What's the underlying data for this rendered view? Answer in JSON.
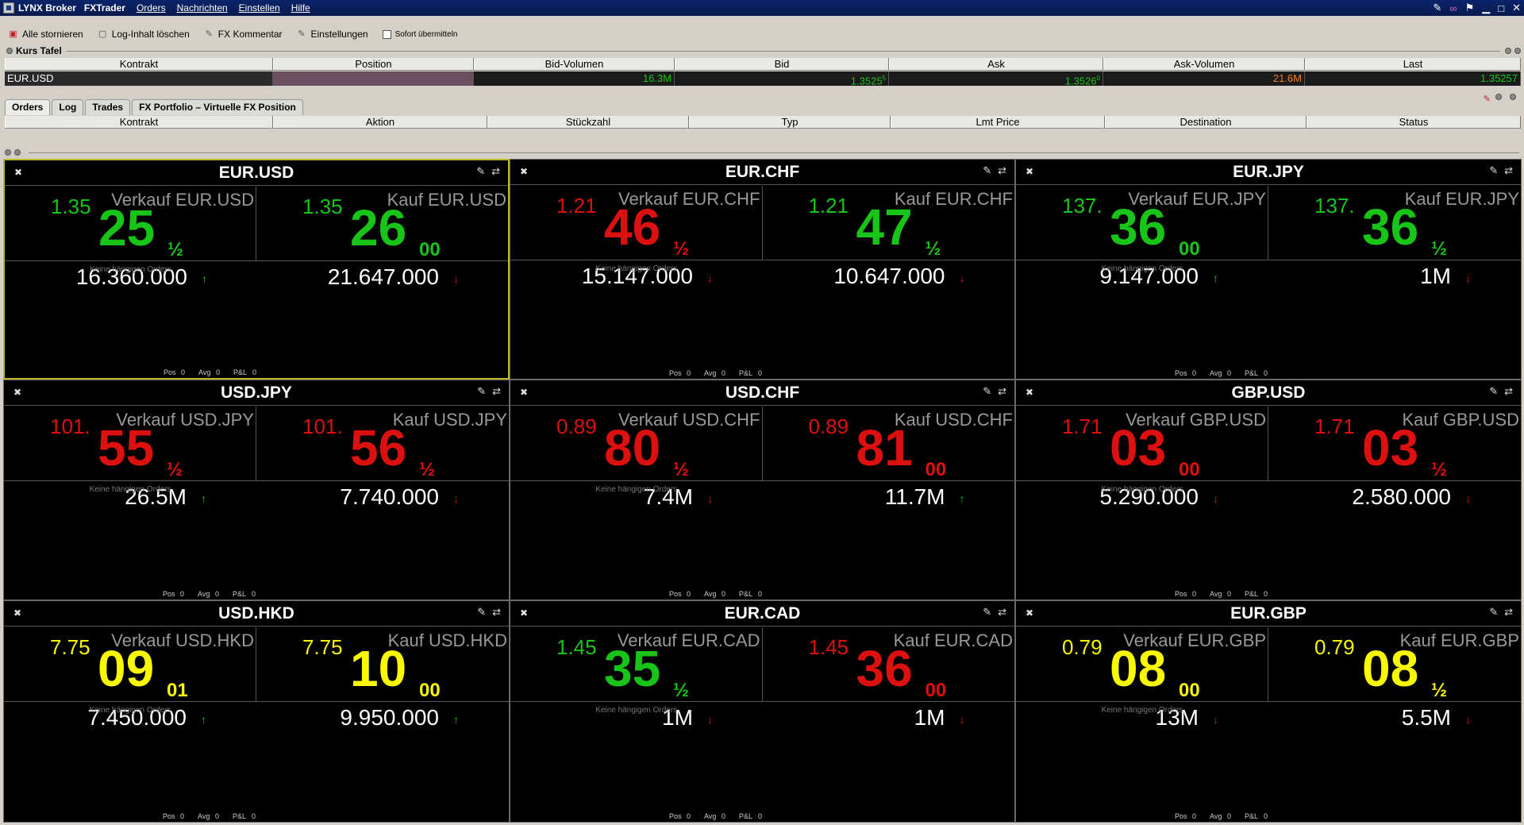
{
  "titlebar": {
    "brand": "LYNX Broker",
    "app": "FXTrader",
    "menus": [
      "Orders",
      "Nachrichten",
      "Einstellen",
      "Hilfe"
    ],
    "right_icons": [
      "wrench-icon",
      "link-icon",
      "flag-icon",
      "minimize-icon",
      "maximize-icon",
      "close-icon"
    ]
  },
  "toolbar": {
    "cancel_all": "Alle stornieren",
    "clear_log": "Log-Inhalt löschen",
    "fx_comment": "FX Kommentar",
    "settings": "Einstellungen",
    "send_now": "Sofort übermitteln"
  },
  "kurs_tafel": {
    "title": "Kurs Tafel",
    "columns": [
      "Kontrakt",
      "Position",
      "Bid-Volumen",
      "Bid",
      "Ask",
      "Ask-Volumen",
      "Last"
    ],
    "row": {
      "kontrakt": "EUR.USD",
      "position": "",
      "bid_volume": "16.3M",
      "bid": "1.3525",
      "bid_sup": "5",
      "ask": "1.3526",
      "ask_sup": "0",
      "ask_volume": "21.6M",
      "last": "1.35257"
    }
  },
  "order_panel": {
    "tabs": [
      "Orders",
      "Log",
      "Trades",
      "FX Portfolio – Virtuelle FX Position"
    ],
    "columns": [
      "Kontrakt",
      "Aktion",
      "Stückzahl",
      "Typ",
      "Lmt Price",
      "Destination",
      "Status"
    ]
  },
  "tiles": [
    {
      "symbol": "EUR.USD",
      "sell_label": "Verkauf EUR.USD",
      "buy_label": "Kauf EUR.USD",
      "bid_prefix": "1.35",
      "bid_big": "25",
      "bid_frac": "½",
      "ask_prefix": "1.35",
      "ask_big": "26",
      "ask_frac": "00",
      "bid_volume": "16.360.000",
      "ask_volume": "21.647.000",
      "bid_trend": "up",
      "ask_trend": "down",
      "bid_color": "green",
      "ask_color": "green",
      "bid_prefix_color": "green",
      "ask_prefix_color": "green",
      "pending": "Keine hängigen Orders",
      "pos": "0",
      "avg": "0",
      "pnl": "0"
    },
    {
      "symbol": "EUR.CHF",
      "sell_label": "Verkauf EUR.CHF",
      "buy_label": "Kauf EUR.CHF",
      "bid_prefix": "1.21",
      "bid_big": "46",
      "bid_frac": "½",
      "ask_prefix": "1.21",
      "ask_big": "47",
      "ask_frac": "½",
      "bid_volume": "15.147.000",
      "ask_volume": "10.647.000",
      "bid_trend": "down",
      "ask_trend": "down",
      "bid_color": "red",
      "ask_color": "green",
      "bid_prefix_color": "red",
      "ask_prefix_color": "green",
      "pending": "Keine hängigen Orders",
      "pos": "0",
      "avg": "0",
      "pnl": "0"
    },
    {
      "symbol": "EUR.JPY",
      "sell_label": "Verkauf EUR.JPY",
      "buy_label": "Kauf EUR.JPY",
      "bid_prefix": "137.",
      "bid_big": "36",
      "bid_frac": "00",
      "ask_prefix": "137.",
      "ask_big": "36",
      "ask_frac": "½",
      "bid_volume": "9.147.000",
      "ask_volume": "1M",
      "bid_trend": "up",
      "ask_trend": "down",
      "bid_color": "green",
      "ask_color": "green",
      "bid_prefix_color": "green",
      "ask_prefix_color": "green",
      "pending": "Keine hängigen Orders",
      "pos": "0",
      "avg": "0",
      "pnl": "0"
    },
    {
      "symbol": "USD.JPY",
      "sell_label": "Verkauf USD.JPY",
      "buy_label": "Kauf USD.JPY",
      "bid_prefix": "101.",
      "bid_big": "55",
      "bid_frac": "½",
      "ask_prefix": "101.",
      "ask_big": "56",
      "ask_frac": "½",
      "bid_volume": "26.5M",
      "ask_volume": "7.740.000",
      "bid_trend": "up",
      "ask_trend": "down",
      "bid_color": "red",
      "ask_color": "red",
      "bid_prefix_color": "red",
      "ask_prefix_color": "red",
      "pending": "Keine hängigen Orders",
      "pos": "0",
      "avg": "0",
      "pnl": "0"
    },
    {
      "symbol": "USD.CHF",
      "sell_label": "Verkauf USD.CHF",
      "buy_label": "Kauf USD.CHF",
      "bid_prefix": "0.89",
      "bid_big": "80",
      "bid_frac": "½",
      "ask_prefix": "0.89",
      "ask_big": "81",
      "ask_frac": "00",
      "bid_volume": "7.4M",
      "ask_volume": "11.7M",
      "bid_trend": "down",
      "ask_trend": "up",
      "bid_color": "red",
      "ask_color": "red",
      "bid_prefix_color": "red",
      "ask_prefix_color": "red",
      "pending": "Keine hängigen Orders",
      "pos": "0",
      "avg": "0",
      "pnl": "0"
    },
    {
      "symbol": "GBP.USD",
      "sell_label": "Verkauf GBP.USD",
      "buy_label": "Kauf GBP.USD",
      "bid_prefix": "1.71",
      "bid_big": "03",
      "bid_frac": "00",
      "ask_prefix": "1.71",
      "ask_big": "03",
      "ask_frac": "½",
      "bid_volume": "5.290.000",
      "ask_volume": "2.580.000",
      "bid_trend": "down",
      "ask_trend": "down",
      "bid_color": "red",
      "ask_color": "red",
      "bid_prefix_color": "red",
      "ask_prefix_color": "red",
      "pending": "Keine hängigen Orders",
      "pos": "0",
      "avg": "0",
      "pnl": "0"
    },
    {
      "symbol": "USD.HKD",
      "sell_label": "Verkauf USD.HKD",
      "buy_label": "Kauf USD.HKD",
      "bid_prefix": "7.75",
      "bid_big": "09",
      "bid_frac": "01",
      "ask_prefix": "7.75",
      "ask_big": "10",
      "ask_frac": "00",
      "bid_volume": "7.450.000",
      "ask_volume": "9.950.000",
      "bid_trend": "up",
      "ask_trend": "up",
      "bid_color": "yellow",
      "ask_color": "yellow",
      "bid_prefix_color": "yellow",
      "ask_prefix_color": "yellow",
      "pending": "Keine hängigen Orders",
      "pos": "0",
      "avg": "0",
      "pnl": "0"
    },
    {
      "symbol": "EUR.CAD",
      "sell_label": "Verkauf EUR.CAD",
      "buy_label": "Kauf EUR.CAD",
      "bid_prefix": "1.45",
      "bid_big": "35",
      "bid_frac": "½",
      "ask_prefix": "1.45",
      "ask_big": "36",
      "ask_frac": "00",
      "bid_volume": "1M",
      "ask_volume": "1M",
      "bid_trend": "down",
      "ask_trend": "down",
      "bid_color": "green",
      "ask_color": "red",
      "bid_prefix_color": "green",
      "ask_prefix_color": "red",
      "pending": "Keine hängigen Orders",
      "pos": "0",
      "avg": "0",
      "pnl": "0"
    },
    {
      "symbol": "EUR.GBP",
      "sell_label": "Verkauf EUR.GBP",
      "buy_label": "Kauf EUR.GBP",
      "bid_prefix": "0.79",
      "bid_big": "08",
      "bid_frac": "00",
      "ask_prefix": "0.79",
      "ask_big": "08",
      "ask_frac": "½",
      "bid_volume": "13M",
      "ask_volume": "5.5M",
      "bid_trend": "down",
      "ask_trend": "down",
      "bid_color": "yellow",
      "ask_color": "yellow",
      "bid_prefix_color": "yellow",
      "ask_prefix_color": "yellow",
      "pending": "Keine hängigen Orders",
      "pos": "0",
      "avg": "0",
      "pnl": "0"
    }
  ],
  "footer_labels": {
    "pos": "Pos",
    "avg": "Avg",
    "pnl": "P&L"
  },
  "colors": {
    "green": "#19c419",
    "red": "#dd1010",
    "yellow": "#f8f800",
    "selected_border": "#b8b828",
    "ask_volume_text": "#f08020"
  }
}
